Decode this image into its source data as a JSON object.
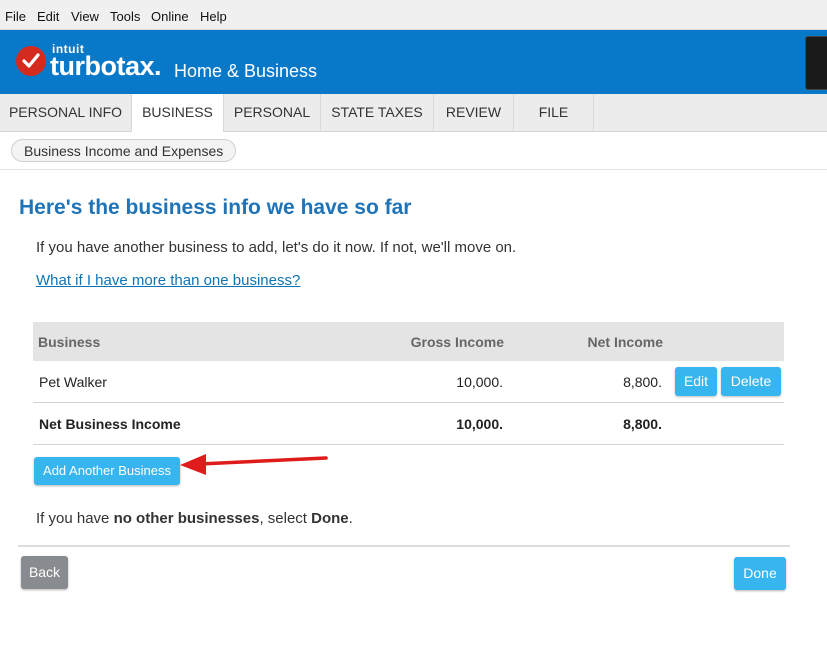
{
  "menu": [
    "File",
    "Edit",
    "View",
    "Tools",
    "Online",
    "Help"
  ],
  "brand": {
    "intuit": "intuit",
    "name": "turbotax.",
    "product": "Home & Business",
    "color": "#0878c9"
  },
  "tabs": [
    {
      "label": "PERSONAL INFO",
      "active": false
    },
    {
      "label": "BUSINESS",
      "active": true
    },
    {
      "label": "PERSONAL",
      "active": false
    },
    {
      "label": "STATE TAXES",
      "active": false
    },
    {
      "label": "REVIEW",
      "active": false
    },
    {
      "label": "FILE",
      "active": false
    }
  ],
  "breadcrumb": "Business Income and Expenses",
  "page": {
    "title": "Here's the business info we have so far",
    "intro": "If you have another business to add, let's do it now. If not, we'll move on.",
    "help_link": "What if I have more than one business?"
  },
  "table": {
    "headers": {
      "business": "Business",
      "gross": "Gross Income",
      "net": "Net Income"
    },
    "rows": [
      {
        "business": "Pet Walker",
        "gross": "10,000.",
        "net": "8,800.",
        "edit": "Edit",
        "delete": "Delete"
      }
    ],
    "total": {
      "label": "Net Business Income",
      "gross": "10,000.",
      "net": "8,800."
    }
  },
  "add_button": "Add Another Business",
  "outro": {
    "pre": "If you have ",
    "bold1": "no other businesses",
    "mid": ", select ",
    "bold2": "Done",
    "post": "."
  },
  "footer": {
    "back": "Back",
    "done": "Done"
  },
  "colors": {
    "accent": "#37b5ef",
    "title": "#1f74b8",
    "arrow": "#e01b1b"
  }
}
